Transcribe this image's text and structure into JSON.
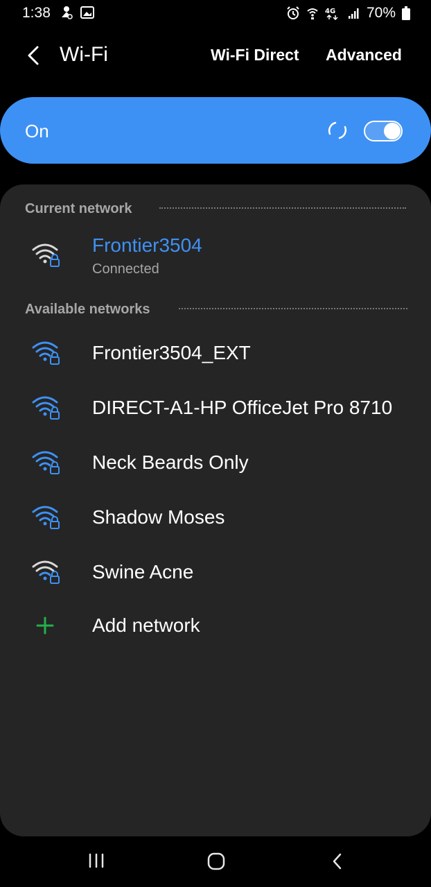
{
  "status_bar": {
    "time": "1:38",
    "battery": "70%",
    "icons": [
      "notification-icon",
      "gallery-icon",
      "alarm-icon",
      "wifi-calling-icon",
      "lte-icon",
      "signal-icon",
      "battery-icon"
    ]
  },
  "header": {
    "title": "Wi-Fi",
    "wifi_direct": "Wi-Fi Direct",
    "advanced": "Advanced"
  },
  "toggle": {
    "label": "On",
    "enabled": true,
    "accent": "#3e91f4"
  },
  "current_network": {
    "section_label": "Current network",
    "name": "Frontier3504",
    "status": "Connected",
    "name_color": "#3e91f4"
  },
  "available_networks": {
    "section_label": "Available networks",
    "items": [
      {
        "name": "Frontier3504_EXT",
        "secured": true,
        "color": "#3e91f4"
      },
      {
        "name": "DIRECT-A1-HP OfficeJet Pro 8710",
        "secured": true,
        "color": "#3e91f4"
      },
      {
        "name": "Neck Beards Only",
        "secured": true,
        "color": "#3e91f4"
      },
      {
        "name": "Shadow Moses",
        "secured": true,
        "color": "#3e91f4"
      },
      {
        "name": "Swine Acne",
        "secured": true,
        "color": "#ffffff"
      }
    ]
  },
  "add_network": {
    "label": "Add network",
    "icon_color": "#22b14c"
  },
  "nav_bar": {
    "icons": [
      "recents-icon",
      "home-icon",
      "back-icon"
    ]
  }
}
